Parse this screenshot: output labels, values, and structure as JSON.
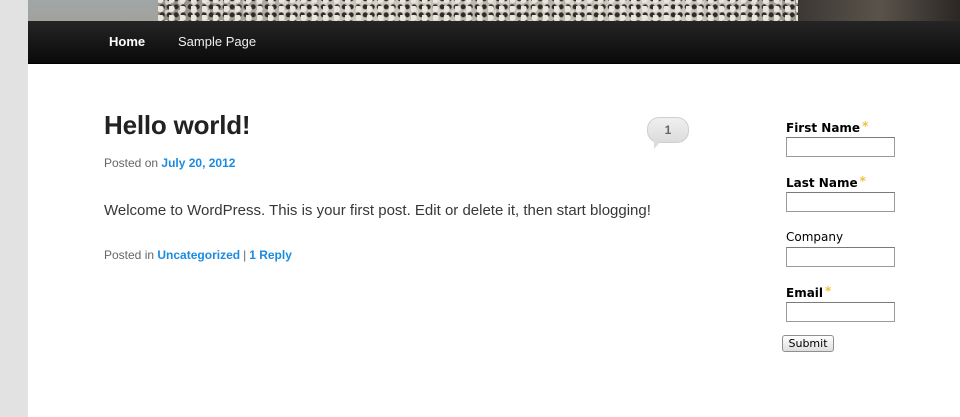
{
  "nav": {
    "items": [
      {
        "label": "Home",
        "active": true
      },
      {
        "label": "Sample Page",
        "active": false
      }
    ]
  },
  "post": {
    "title": "Hello world!",
    "comment_count": "1",
    "meta_prefix": "Posted on",
    "date": "July 20, 2012",
    "content": "Welcome to WordPress. This is your first post. Edit or delete it, then start blogging!",
    "footer_prefix": "Posted in",
    "category": "Uncategorized",
    "separator": "|",
    "reply_link": "1 Reply"
  },
  "form": {
    "first_name_label": "First Name",
    "first_name_value": "",
    "last_name_label": "Last Name",
    "last_name_value": "",
    "company_label": "Company",
    "company_value": "",
    "email_label": "Email",
    "email_value": "",
    "required_marker": "*",
    "submit_label": "Submit"
  },
  "colors": {
    "link": "#1b8be0",
    "required_star": "#f0c23a",
    "nav_background": "#111111"
  }
}
